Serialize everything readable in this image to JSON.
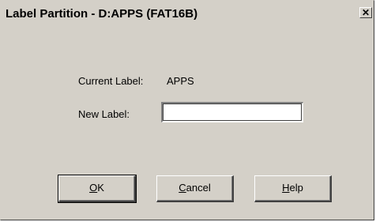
{
  "window": {
    "title": "Label Partition - D:APPS (FAT16B)",
    "close_glyph": "✕"
  },
  "form": {
    "current_label_caption": "Current Label:",
    "current_label_value": "APPS",
    "new_label_caption": "New Label:",
    "new_label_value": "",
    "new_label_placeholder": ""
  },
  "buttons": {
    "ok": {
      "mnemonic": "O",
      "rest": "K"
    },
    "cancel": {
      "mnemonic": "C",
      "rest": "ancel"
    },
    "help": {
      "mnemonic": "H",
      "rest": "elp"
    }
  },
  "colors": {
    "dialog_face": "#d4d0c8",
    "text": "#000000",
    "input_bg": "#ffffff"
  },
  "icons": [
    "close-icon"
  ]
}
